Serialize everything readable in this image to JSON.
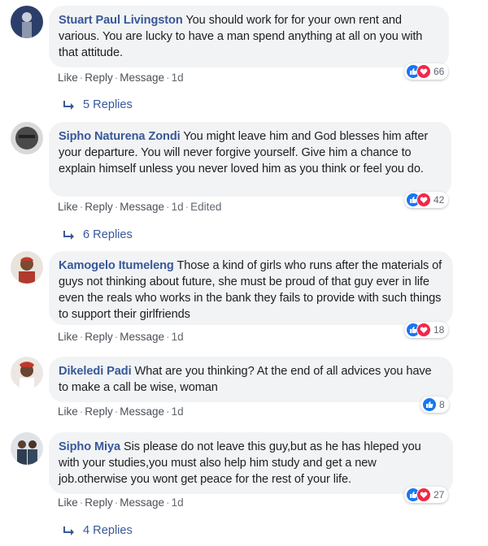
{
  "comments": [
    {
      "author": "Stuart Paul Livingston",
      "text": "You should work for for your own rent and various. You are lucky to have a man spend anything at all on you with that attitude.",
      "actions": {
        "like": "Like",
        "reply": "Reply",
        "message": "Message",
        "time": "1d",
        "edited": ""
      },
      "reactions": {
        "count": "66",
        "types": [
          "like",
          "love"
        ]
      },
      "replies": "5 Replies"
    },
    {
      "author": "Sipho Naturena Zondi",
      "text": "You might leave him and God blesses him after your departure. You will never forgive yourself. Give him a chance to explain himself unless you never loved him as you think or feel you do.",
      "actions": {
        "like": "Like",
        "reply": "Reply",
        "message": "Message",
        "time": "1d",
        "edited": "Edited"
      },
      "reactions": {
        "count": "42",
        "types": [
          "like",
          "love"
        ]
      },
      "replies": "6 Replies"
    },
    {
      "author": "Kamogelo Itumeleng",
      "text": "Those a kind of girls who runs after the materials of guys not thinking about future, she must be proud of that guy ever in life even the reals who works in the bank they fails to provide with such things to support their girlfriends",
      "actions": {
        "like": "Like",
        "reply": "Reply",
        "message": "Message",
        "time": "1d",
        "edited": ""
      },
      "reactions": {
        "count": "18",
        "types": [
          "like",
          "love"
        ]
      },
      "replies": ""
    },
    {
      "author": "Dikeledi Padi",
      "text": "What are you thinking? At the end of all advices you have to make a call be wise, woman",
      "actions": {
        "like": "Like",
        "reply": "Reply",
        "message": "Message",
        "time": "1d",
        "edited": ""
      },
      "reactions": {
        "count": "8",
        "types": [
          "like"
        ]
      },
      "replies": ""
    },
    {
      "author": "Sipho Miya",
      "text": "Sis please do not leave this guy,but as he has hleped you with your studies,you must also help him study and get a new job.otherwise you wont get peace for the rest of your life.",
      "actions": {
        "like": "Like",
        "reply": "Reply",
        "message": "Message",
        "time": "1d",
        "edited": ""
      },
      "reactions": {
        "count": "27",
        "types": [
          "like",
          "love"
        ]
      },
      "replies": "4 Replies"
    }
  ],
  "colors": {
    "author": "#385898",
    "bubble": "#f2f3f5",
    "like": "#1877f2",
    "love": "#f0284a"
  }
}
